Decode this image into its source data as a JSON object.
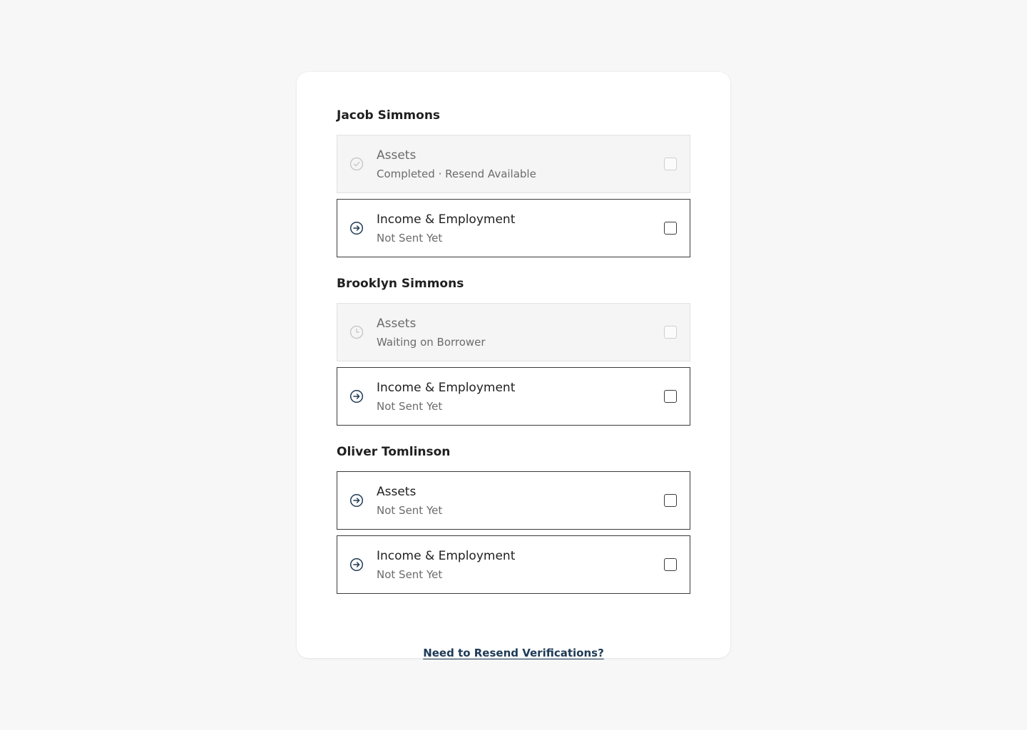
{
  "colors": {
    "page_background": "#f7f7f7",
    "card_background": "#ffffff",
    "accent": "#1e3a56",
    "disabled_background": "#f5f5f5",
    "muted_text": "#6b6b6b"
  },
  "borrowers": [
    {
      "name": "Jacob Simmons",
      "items": [
        {
          "title": "Assets",
          "status": "Completed · Resend Available",
          "state": "disabled",
          "icon": "check-circle-icon",
          "checked": false
        },
        {
          "title": "Income & Employment",
          "status": "Not Sent Yet",
          "state": "active",
          "icon": "arrow-right-circle-icon",
          "checked": false
        }
      ]
    },
    {
      "name": "Brooklyn Simmons",
      "items": [
        {
          "title": "Assets",
          "status": "Waiting on Borrower",
          "state": "disabled",
          "icon": "clock-icon",
          "checked": false
        },
        {
          "title": "Income & Employment",
          "status": "Not Sent Yet",
          "state": "active",
          "icon": "arrow-right-circle-icon",
          "checked": false
        }
      ]
    },
    {
      "name": "Oliver Tomlinson",
      "items": [
        {
          "title": "Assets",
          "status": "Not Sent Yet",
          "state": "active",
          "icon": "arrow-right-circle-icon",
          "checked": false
        },
        {
          "title": "Income & Employment",
          "status": "Not Sent Yet",
          "state": "active",
          "icon": "arrow-right-circle-icon",
          "checked": false
        }
      ]
    }
  ],
  "footer": {
    "resend_link": "Need to Resend Verifications?"
  }
}
